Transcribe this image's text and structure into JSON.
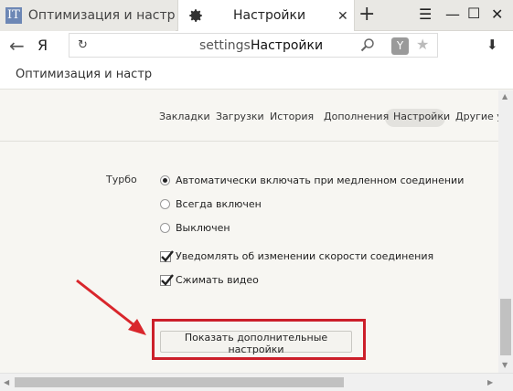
{
  "tabs": [
    {
      "label": "Оптимизация и настройка",
      "favicon": "IT"
    },
    {
      "label": "Настройки",
      "icon": "gear-icon"
    }
  ],
  "window_controls": {
    "menu": "☰",
    "minimize": "—",
    "maximize": "☐",
    "close": "✕"
  },
  "address_bar": {
    "logo": "Я",
    "host": "settings",
    "page_title": "Настройки"
  },
  "bookmarks": [
    {
      "label": "Оптимизация и настр"
    }
  ],
  "settings_nav": [
    "Закладки",
    "Загрузки",
    "История",
    "Дополнения",
    "Настройки",
    "Другие устрой"
  ],
  "turbo": {
    "label": "Турбо",
    "options": [
      {
        "label": "Автоматически включать при медленном соединении",
        "selected": true
      },
      {
        "label": "Всегда включен",
        "selected": false
      },
      {
        "label": "Выключен",
        "selected": false
      }
    ],
    "checkboxes": [
      {
        "label": "Уведомлять об изменении скорости соединения",
        "checked": true
      },
      {
        "label": "Сжимать видео",
        "checked": true
      }
    ]
  },
  "more_settings_button": "Показать дополнительные настройки",
  "colors": {
    "highlight": "#cc1f2a",
    "arrow": "#d9262c"
  }
}
